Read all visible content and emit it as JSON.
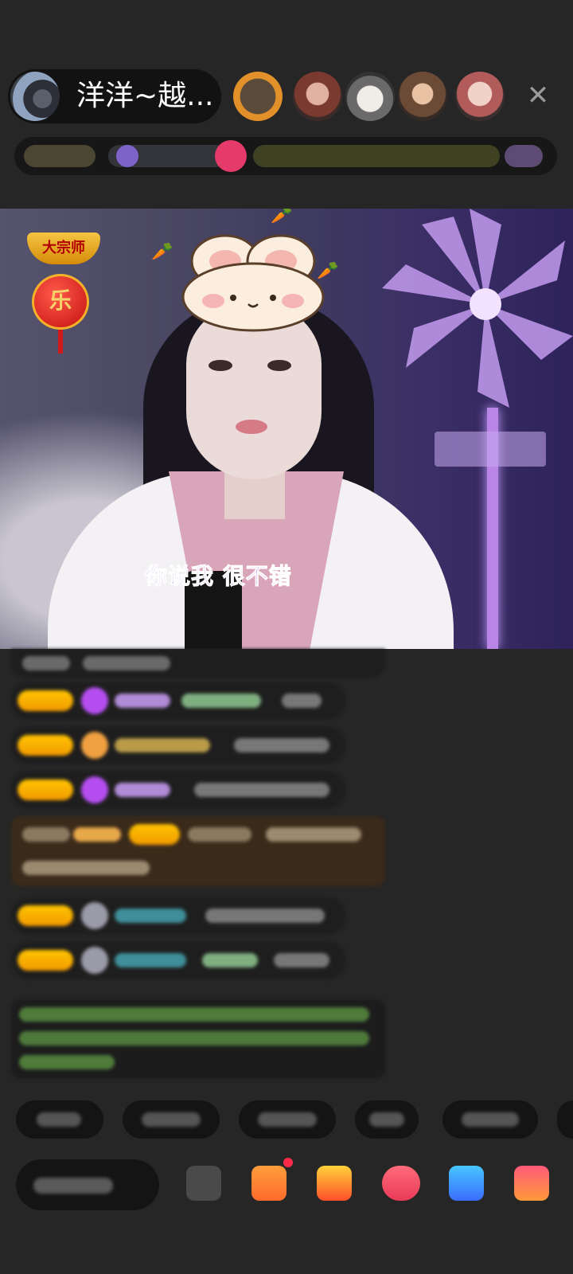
{
  "header": {
    "host_name": "洋洋~越...",
    "close_icon": "close-icon"
  },
  "stream": {
    "badge_text": "大宗师",
    "lantern_text": "乐",
    "subtitle": "你说我  很不错"
  },
  "colors": {
    "background": "#262626",
    "level_badge": "#f5b400",
    "subtitle": "#9c4fd8"
  }
}
